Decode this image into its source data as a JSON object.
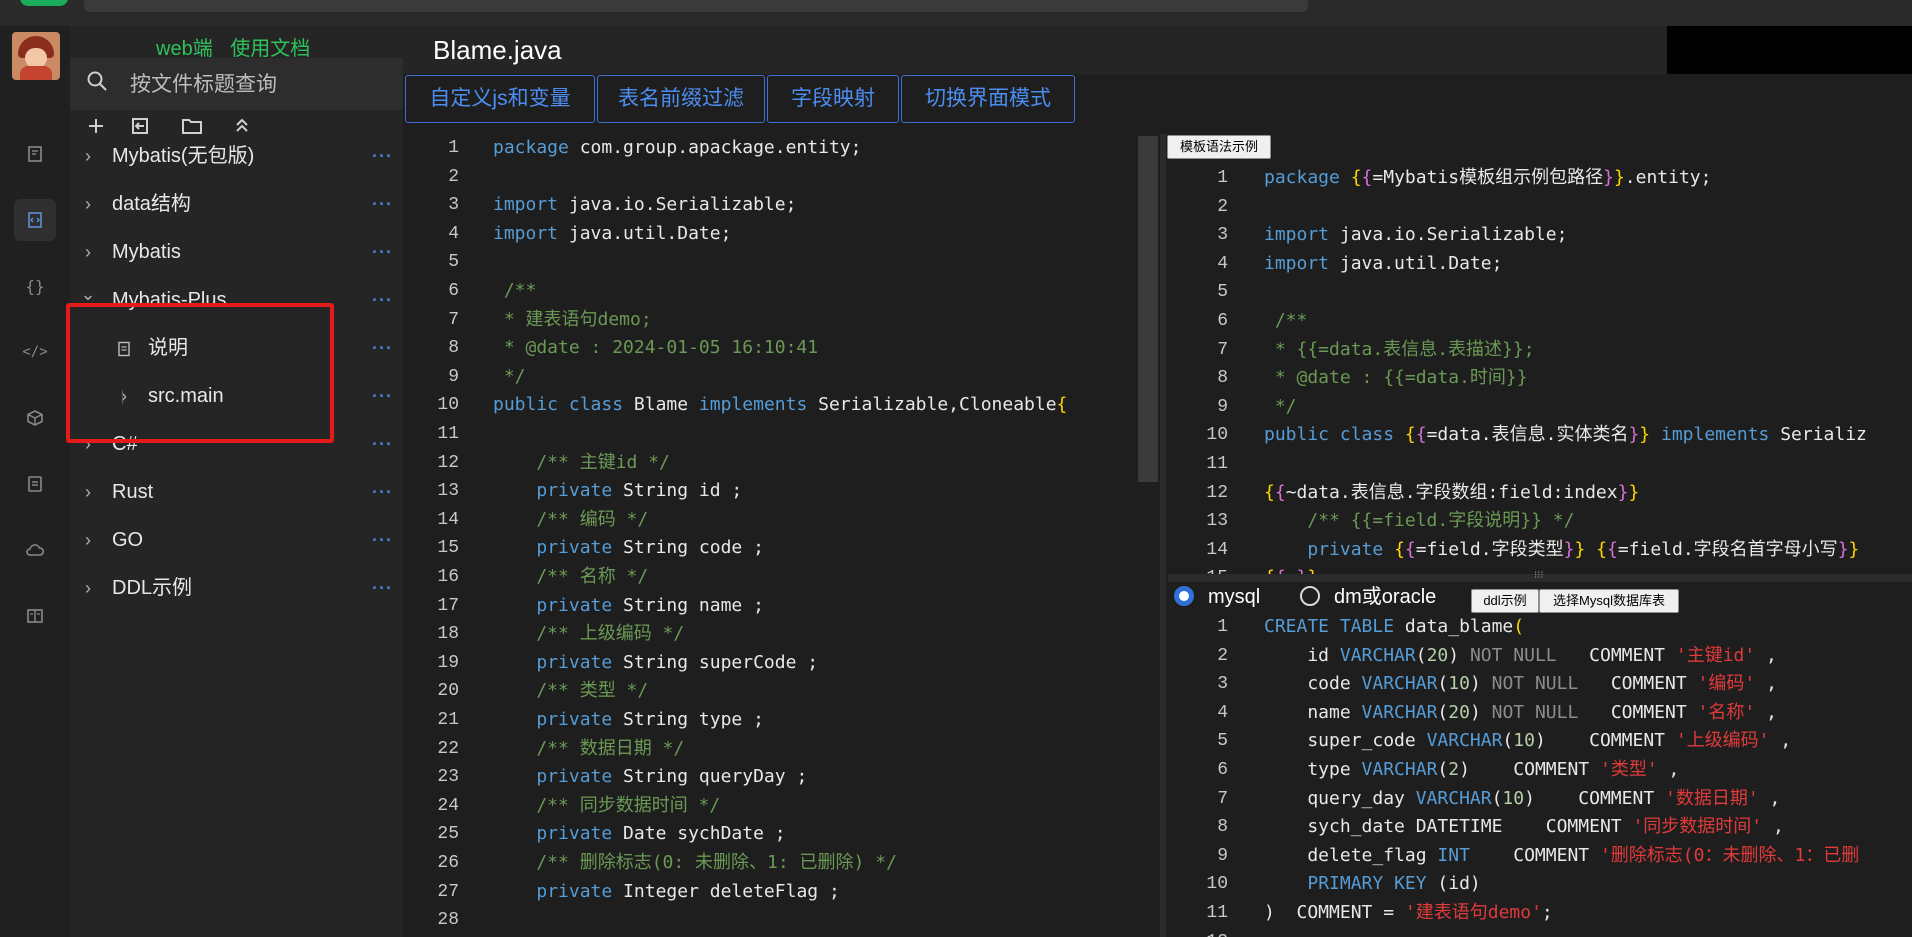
{
  "sidebar": {
    "doc_links": [
      "web端",
      "使用文档"
    ],
    "search_placeholder": "按文件标题查询",
    "tree": [
      {
        "label": "Mybatis(无包版)",
        "expanded": false
      },
      {
        "label": "data结构",
        "expanded": false
      },
      {
        "label": "Mybatis",
        "expanded": false
      },
      {
        "label": "Mybatis-Plus",
        "expanded": true,
        "children": [
          {
            "label": "说明",
            "type": "file"
          },
          {
            "label": "src.main",
            "type": "folder"
          }
        ]
      },
      {
        "label": "C#",
        "expanded": false
      },
      {
        "label": "Rust",
        "expanded": false
      },
      {
        "label": "GO",
        "expanded": false
      },
      {
        "label": "DDL示例",
        "expanded": false
      }
    ],
    "more_glyph": "···"
  },
  "editor": {
    "file_title": "Blame.java",
    "toolbar_buttons": [
      "自定义js和变量",
      "表名前缀过滤",
      "字段映射",
      "切换界面模式"
    ],
    "template_example_button": "模板语法示例",
    "db_radio": {
      "selected": "mysql",
      "options": [
        "mysql",
        "dm或oracle"
      ]
    },
    "ddl_buttons": [
      "ddl示例",
      "选择Mysql数据库表"
    ]
  },
  "java_code": [
    "package com.group.apackage.entity;",
    "",
    "import java.io.Serializable;",
    "import java.util.Date;",
    "",
    " /**",
    " * 建表语句demo;",
    " * @date : 2024-01-05 16:10:41",
    " */",
    "public class Blame implements Serializable,Cloneable{",
    "",
    "    /** 主键id */",
    "    private String id ;",
    "    /** 编码 */",
    "    private String code ;",
    "    /** 名称 */",
    "    private String name ;",
    "    /** 上级编码 */",
    "    private String superCode ;",
    "    /** 类型 */",
    "    private String type ;",
    "    /** 数据日期 */",
    "    private String queryDay ;",
    "    /** 同步数据时间 */",
    "    private Date sychDate ;",
    "    /** 删除标志(0: 未删除、1: 已删除) */",
    "    private Integer deleteFlag ;",
    ""
  ],
  "template_code": [
    "package {{=Mybatis模板组示例包路径}}.entity;",
    "",
    "import java.io.Serializable;",
    "import java.util.Date;",
    "",
    " /**",
    " * {{=data.表信息.表描述}};",
    " * @date : {{=data.时间}}",
    " */",
    "public class {{=data.表信息.实体类名}} implements Serializ",
    "",
    "{{~data.表信息.字段数组:field:index}}",
    "    /** {{=field.字段说明}} */",
    "    private {{=field.字段类型}} {{=field.字段名首字母小写}}",
    "{{~}}"
  ],
  "sql_code": [
    "CREATE TABLE data_blame(",
    "    id VARCHAR(20) NOT NULL   COMMENT '主键id' ,",
    "    code VARCHAR(10) NOT NULL   COMMENT '编码' ,",
    "    name VARCHAR(20) NOT NULL   COMMENT '名称' ,",
    "    super_code VARCHAR(10)    COMMENT '上级编码' ,",
    "    type VARCHAR(2)    COMMENT '类型' ,",
    "    query_day VARCHAR(10)    COMMENT '数据日期' ,",
    "    sych_date DATETIME    COMMENT '同步数据时间' ,",
    "    delete_flag INT    COMMENT '删除标志(0：未删除、1：已删",
    "    PRIMARY KEY (id)",
    ")  COMMENT = '建表语句demo';",
    ""
  ],
  "line_number_labels": [
    "1",
    "2",
    "3",
    "4",
    "5",
    "6",
    "7",
    "8",
    "9",
    "10",
    "11",
    "12",
    "13",
    "14",
    "15",
    "16",
    "17",
    "18",
    "19",
    "20",
    "21",
    "22",
    "23",
    "24",
    "25",
    "26",
    "27",
    "28"
  ],
  "colors": {
    "doc_link": "#2ec35a",
    "keyword": "#569cd6",
    "comment": "#6a9955",
    "string": "#e03a3a",
    "bracket": "#ffd700",
    "accent_button": "#4b8df0",
    "annotation_box": "#e31b1b"
  },
  "icons": {
    "rail": [
      "notes-icon",
      "code-file-icon",
      "braces-icon",
      "code-tag-icon",
      "cube-icon",
      "document-icon",
      "cloud-icon",
      "book-icon"
    ],
    "tree_tools": [
      "add-icon",
      "import-icon",
      "folder-icon",
      "collapse-icon"
    ]
  }
}
